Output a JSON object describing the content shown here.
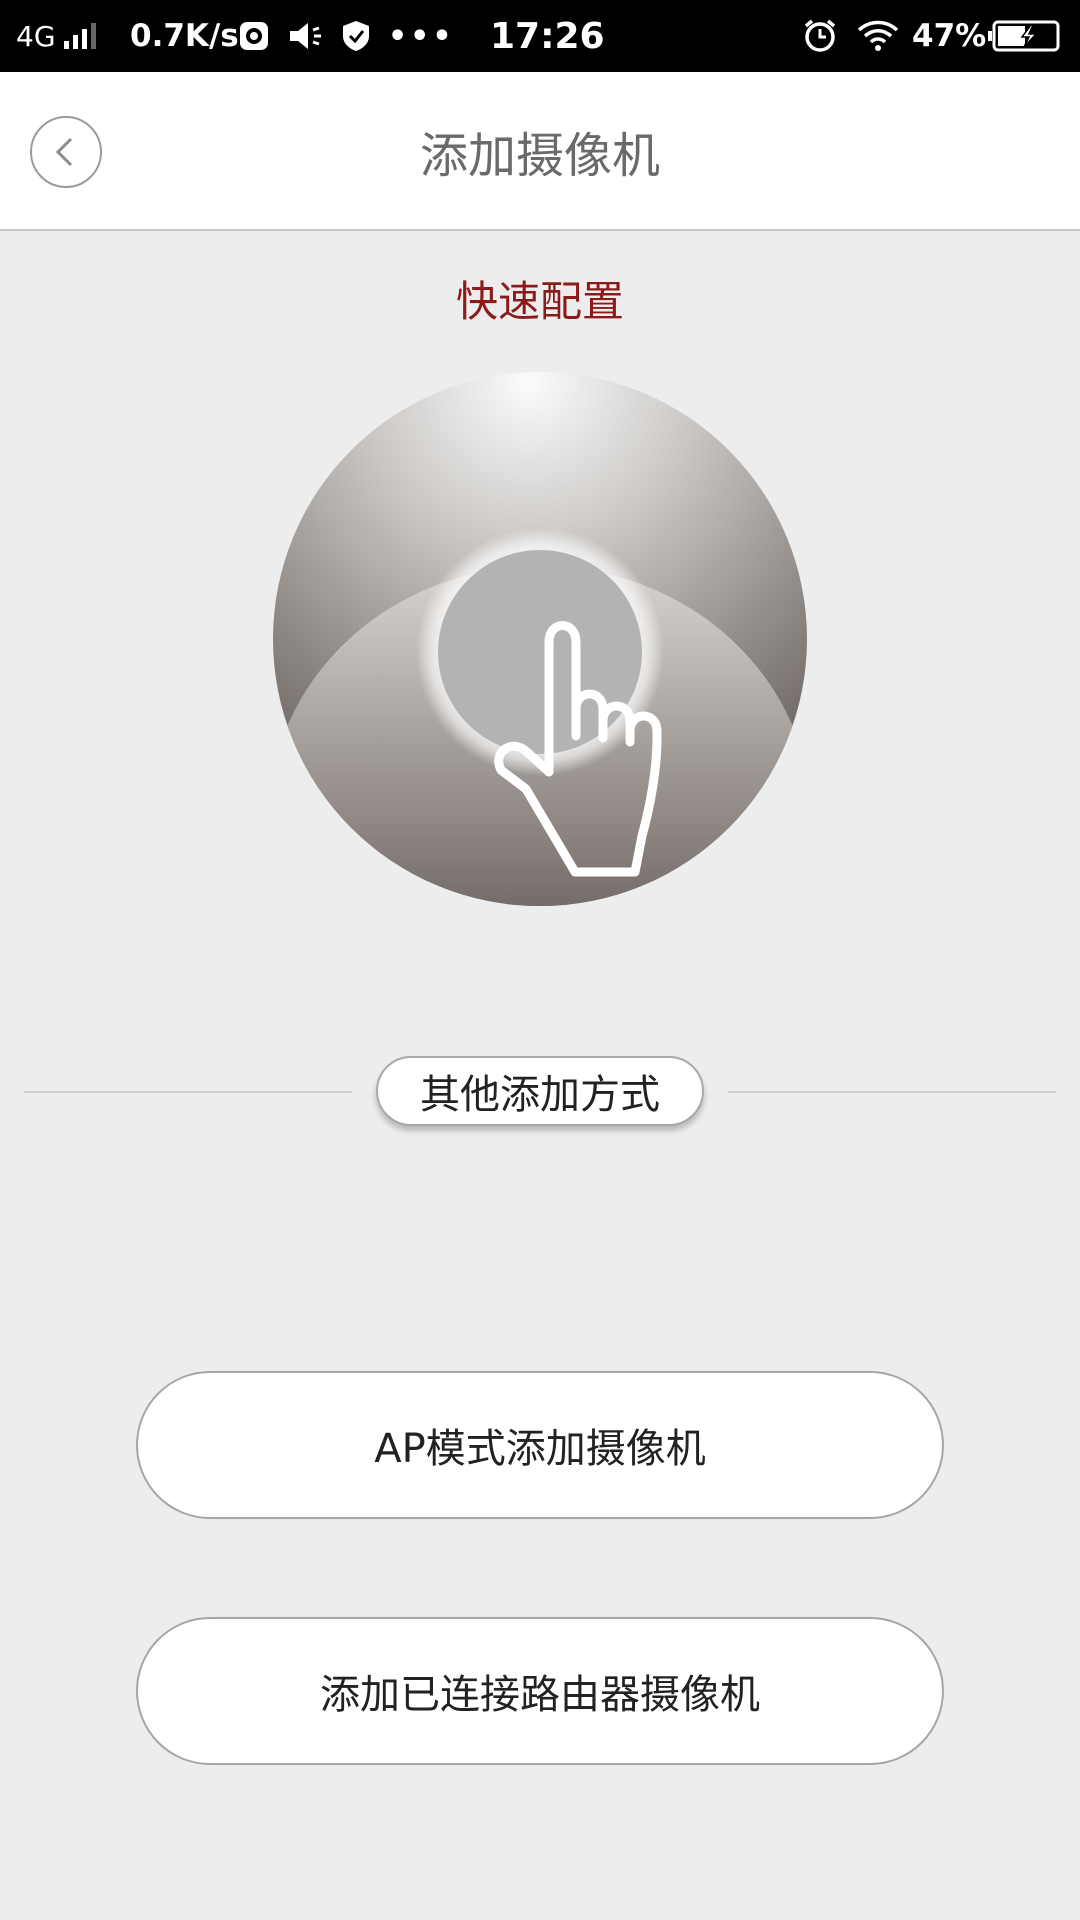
{
  "status_bar": {
    "network": "4G",
    "speed": "0.7K/s",
    "more": "•••",
    "time": "17:26",
    "battery_percent": "47%"
  },
  "header": {
    "title": "添加摄像机",
    "back_icon": "chevron-left-icon"
  },
  "quick_config": {
    "title": "快速配置",
    "icon": "tap-hand-icon"
  },
  "other_methods": {
    "label": "其他添加方式"
  },
  "options": {
    "ap_mode_label": "AP模式添加摄像机",
    "router_label": "添加已连接路由器摄像机"
  },
  "colors": {
    "accent_title": "#8b1a1a",
    "background": "#ededed",
    "header_bg": "#ffffff"
  }
}
